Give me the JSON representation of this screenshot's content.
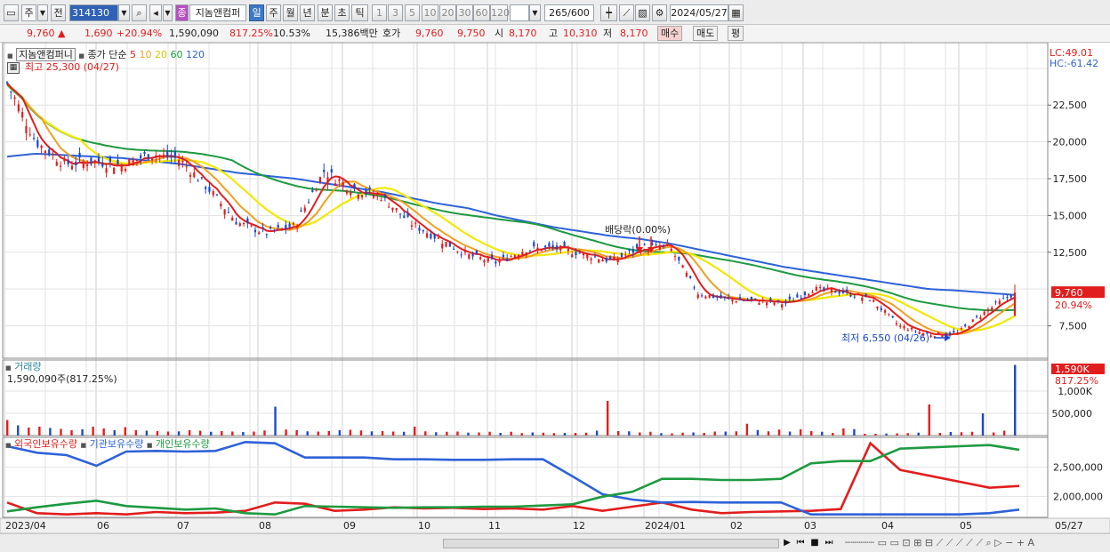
{
  "toolbar": {
    "period_main": "주",
    "prev_label": "전",
    "stock_code": "314130",
    "stock_name": "지놈앤컴퍼",
    "periods": [
      "일",
      "주",
      "월",
      "년",
      "분",
      "초",
      "틱"
    ],
    "active_period": "일",
    "intervals": [
      "1",
      "3",
      "5",
      "10",
      "20",
      "30",
      "60",
      "120"
    ],
    "count_display": "265",
    "count_total": "/600",
    "date": "2024/05/27",
    "jong_badge": "종"
  },
  "quote": {
    "price": "9,760",
    "arrow": "▲",
    "change": "1,690",
    "change_pct": "+20.94%",
    "volume": "1,590,090",
    "volume_ratio": "817.25%",
    "turnover": "10.53%",
    "amount": "15,386백만",
    "hoga_label": "호가",
    "hoga1": "9,760",
    "hoga2": "9,750",
    "open_label": "시",
    "open": "8,170",
    "high_label": "고",
    "high": "10,310",
    "low_label": "저",
    "low": "8,170",
    "buy_label": "매수",
    "sell_label": "매도",
    "eval_label": "평"
  },
  "price_panel": {
    "name_tag": "지놈앤컴퍼니",
    "ma_prefix": "종가 단순",
    "ma_periods": [
      "5",
      "10",
      "20",
      "60",
      "120"
    ],
    "ma_colors": [
      "#e02020",
      "#f0a020",
      "#f2e800",
      "#1e9a40",
      "#2e62d8"
    ],
    "high_marker": "최고 25,300 (04/27)",
    "low_marker": "최저 6,550 (04/26)",
    "dividend_marker": "배당락(0.00%)",
    "lc": "LC:49.01",
    "hc": "HC:-61.42",
    "current_price": "9,760",
    "current_pct": "20.94%",
    "y_ticks": [
      "22,500",
      "20,000",
      "17,500",
      "15,000",
      "12,500",
      "9,760",
      "7,500"
    ],
    "up_color": "#e21d1d",
    "down_color": "#1b49c9"
  },
  "volume_panel": {
    "title": "거래량",
    "value_text": "1,590,090주(817.25%)",
    "current_badge": "1,590K",
    "current_pct": "817.25%",
    "y_ticks": [
      "1,000K",
      "500,000"
    ]
  },
  "holdings_panel": {
    "series_labels": [
      "외국인보유수량",
      "기관보유수량",
      "개인보유수량"
    ],
    "series_colors": [
      "#e21d1d",
      "#2e62d8",
      "#1e9a40"
    ],
    "y_ticks": [
      "2,500,000",
      "2,000,000"
    ]
  },
  "x_axis": {
    "labels": [
      "2023/04",
      "06",
      "07",
      "08",
      "09",
      "10",
      "11",
      "12",
      "2024/01",
      "02",
      "03",
      "04",
      "05"
    ],
    "last_label": "05/27"
  },
  "chart_data": [
    {
      "type": "line",
      "title": "",
      "series": [
        {
          "name": "5",
          "values": [
            24000,
            20000,
            18500,
            18700,
            18400,
            19200,
            18800,
            16800,
            14500,
            13800,
            14300,
            18000,
            16800,
            16300,
            14500,
            13400,
            12300,
            11800,
            12700,
            12800,
            12400,
            11900,
            12800,
            12900,
            9700,
            9300,
            9200,
            9000,
            10000,
            9800,
            9300,
            7500,
            6900,
            7000,
            8500,
            9760
          ]
        },
        {
          "name": "120",
          "values": [
            19000,
            19200,
            19100,
            19000,
            18900,
            18700,
            18500,
            18200,
            17900,
            17700,
            17500,
            17200,
            16900,
            16600,
            16200,
            15800,
            15500,
            15000,
            14600,
            14200,
            13900,
            13600,
            13400,
            13100,
            12700,
            12300,
            11900,
            11500,
            11200,
            10900,
            10600,
            10300,
            10000,
            9900,
            9750,
            9600
          ]
        }
      ],
      "ylim": [
        5300,
        26500
      ]
    },
    {
      "type": "bar",
      "title": "거래량",
      "values": [
        350000,
        230000,
        180000,
        200000,
        170000,
        150000,
        120000,
        140000,
        200000,
        160000,
        120000,
        190000,
        120000,
        110000,
        100000,
        90000,
        95000,
        120000,
        110000,
        85000,
        100000,
        90000,
        80000,
        90000,
        115000,
        650000,
        135000,
        120000,
        95000,
        90000,
        100000,
        120000,
        130000,
        115000,
        95000,
        100000,
        90000,
        85000,
        200000,
        95000,
        75000,
        85000,
        90000,
        65000,
        70000,
        85000,
        60000,
        85000,
        55000,
        70000,
        65000,
        55000,
        60000,
        60000,
        65000,
        110000,
        780000,
        100000,
        95000,
        70000,
        85000,
        55000,
        50000,
        65000,
        70000,
        60000,
        90000,
        90000,
        95000,
        265000,
        125000,
        95000,
        135000,
        90000,
        140000,
        100000,
        85000,
        60000,
        160000,
        145000,
        40000,
        40000,
        45000,
        50000,
        55000,
        65000,
        700000,
        60000,
        80000,
        75000,
        85000,
        500000,
        70000,
        110000,
        1590090
      ],
      "ylim": [
        0,
        1700000
      ]
    },
    {
      "type": "line",
      "title": "",
      "series": [
        {
          "name": "외국인보유수량",
          "values": [
            1900000,
            1720000,
            1700000,
            1720000,
            1700000,
            1740000,
            1720000,
            1730000,
            1760000,
            1900000,
            1880000,
            1760000,
            1780000,
            1820000,
            1800000,
            1810000,
            1790000,
            1800000,
            1780000,
            1840000,
            1760000,
            1830000,
            1900000,
            1780000,
            1720000,
            1740000,
            1750000,
            1760000,
            1790000,
            2900000,
            2450000,
            2350000,
            2250000,
            2150000,
            2180000
          ]
        },
        {
          "name": "기관보유수량",
          "values": [
            2850000,
            2740000,
            2700000,
            2520000,
            2760000,
            2770000,
            2760000,
            2770000,
            2920000,
            2900000,
            2660000,
            2660000,
            2660000,
            2630000,
            2630000,
            2620000,
            2620000,
            2630000,
            2630000,
            2340000,
            2040000,
            1950000,
            1900000,
            1910000,
            1900000,
            1900000,
            1900000,
            1700000,
            1700000,
            1700000,
            1700000,
            1700000,
            1700000,
            1720000,
            1780000
          ]
        },
        {
          "name": "개인보유수량",
          "values": [
            1750000,
            1820000,
            1880000,
            1930000,
            1840000,
            1810000,
            1780000,
            1800000,
            1720000,
            1700000,
            1840000,
            1830000,
            1820000,
            1810000,
            1820000,
            1820000,
            1830000,
            1830000,
            1850000,
            1870000,
            2000000,
            2080000,
            2300000,
            2300000,
            2280000,
            2280000,
            2300000,
            2560000,
            2600000,
            2600000,
            2810000,
            2830000,
            2850000,
            2870000,
            2790000
          ]
        }
      ],
      "ylim": [
        1650000,
        3000000
      ]
    }
  ]
}
